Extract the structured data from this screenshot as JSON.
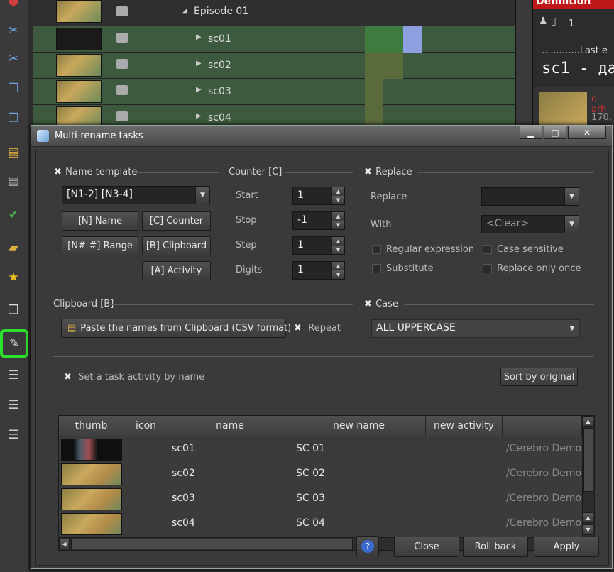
{
  "background": {
    "episode_label": "Episode 01",
    "rows": [
      "sc01",
      "sc02",
      "sc03",
      "sc04"
    ],
    "right_panel": {
      "header": "Definition",
      "count": "1",
      "text1": ".............Last e",
      "text2": "sc1 - да",
      "text3": "o-arh",
      "text4": "170,"
    }
  },
  "dialog": {
    "title": "Multi-rename tasks",
    "window_buttons": {
      "minimize": "▁",
      "maximize": "□",
      "close": "✕"
    },
    "name_template": {
      "label": "Name template",
      "value": "[N1-2] [N3-4]",
      "buttons": {
        "name": "[N] Name",
        "counter": "[C] Counter",
        "range": "[N#-#] Range",
        "clipboard": "[B] Clipboard",
        "activity": "[A] Activity"
      }
    },
    "counter": {
      "label": "Counter [C]",
      "fields": [
        {
          "label": "Start",
          "value": "1"
        },
        {
          "label": "Stop",
          "value": "-1"
        },
        {
          "label": "Step",
          "value": "1"
        },
        {
          "label": "Digits",
          "value": "1"
        }
      ]
    },
    "replace": {
      "label": "Replace",
      "replace_label": "Replace",
      "replace_value": "",
      "with_label": "With",
      "with_value": "<Clear>",
      "options": {
        "regex": "Regular expression",
        "case_sensitive": "Case sensitive",
        "substitute": "Substitute",
        "replace_once": "Replace only once"
      }
    },
    "clipboard": {
      "label": "Clipboard [B]",
      "paste_button": "Paste the names from Clipboard (CSV format)",
      "repeat_label": "Repeat"
    },
    "case": {
      "label": "Case",
      "value": "ALL UPPERCASE"
    },
    "activity_label": "Set a task activity by name",
    "sort_button": "Sort by original",
    "table": {
      "headers": [
        "thumb",
        "icon",
        "name",
        "new name",
        "new activity"
      ],
      "rows": [
        {
          "name": "sc01",
          "new_name": "SC 01",
          "path": "/Cerebro Demo"
        },
        {
          "name": "sc02",
          "new_name": "SC 02",
          "path": "/Cerebro Demo"
        },
        {
          "name": "sc03",
          "new_name": "SC 03",
          "path": "/Cerebro Demo"
        },
        {
          "name": "sc04",
          "new_name": "SC 04",
          "path": "/Cerebro Demo"
        }
      ]
    },
    "footer": {
      "help": "?",
      "close": "Close",
      "rollback": "Roll back",
      "apply": "Apply"
    }
  }
}
